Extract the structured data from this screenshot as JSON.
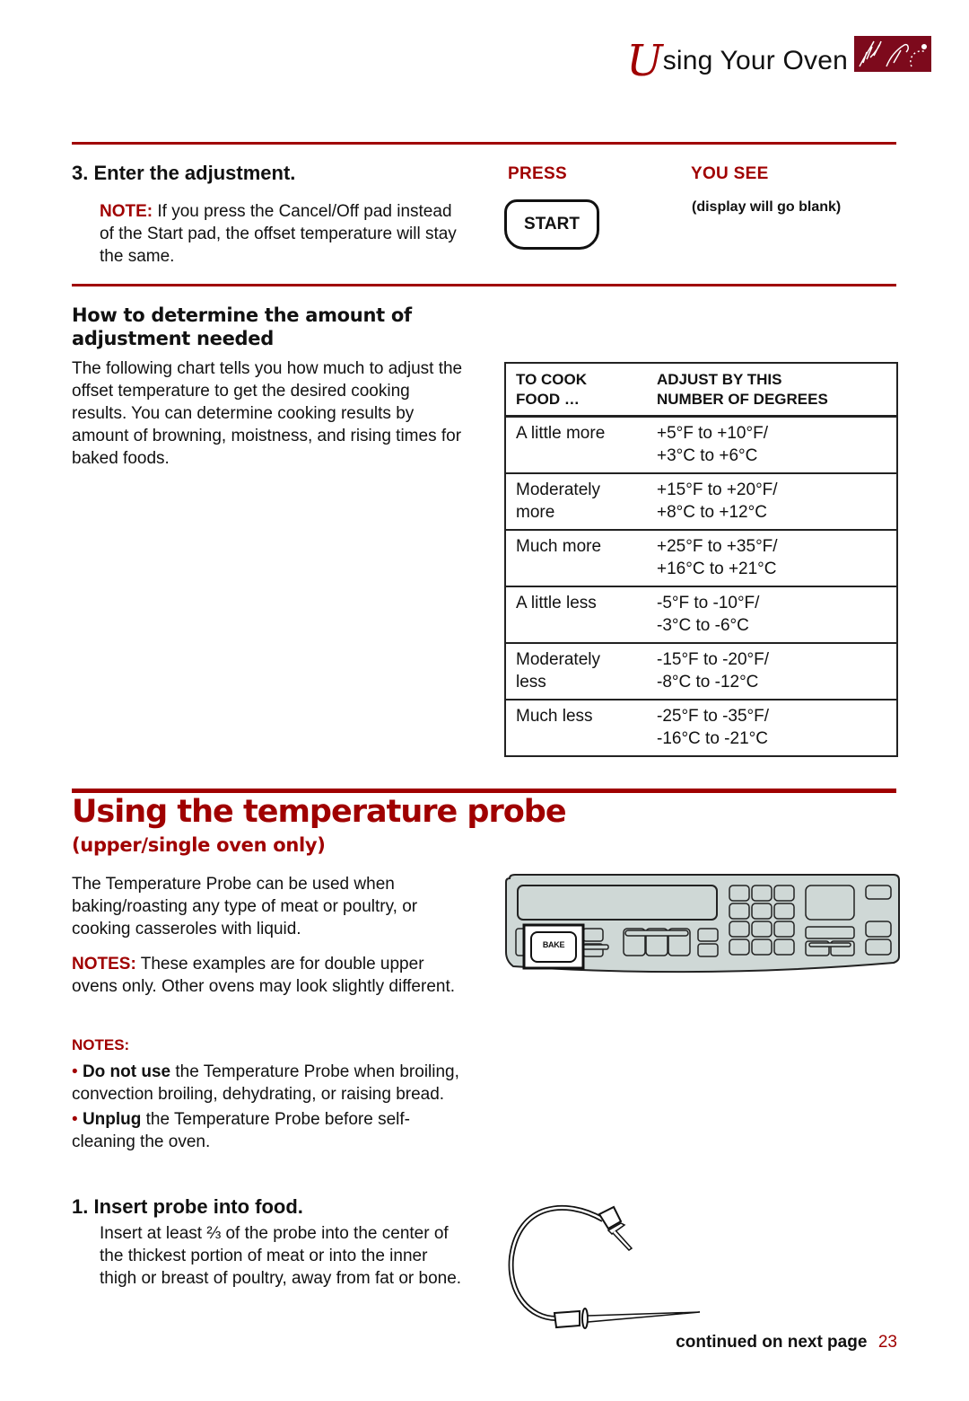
{
  "header": {
    "title_initial": "U",
    "title_rest": "sing Your Oven",
    "logo_icon": "decorative-flourish-logo"
  },
  "step3": {
    "title": "3. Enter the adjustment.",
    "note_label": "NOTE:",
    "note_text": " If you press the Cancel/Off pad instead of the Start pad, the offset temperature will stay the same.",
    "press_header": "PRESS",
    "you_see_header": "YOU SEE",
    "button_label": "START",
    "you_see_text": "(display will go blank)"
  },
  "adjustment": {
    "heading": "How to determine the amount of adjustment needed",
    "body": "The following chart tells you how much to adjust the offset temperature to get the desired cooking results. You can determine cooking results by amount of browning, moistness, and rising times for baked foods.",
    "table": {
      "headers": [
        "TO COOK FOOD …",
        "ADJUST BY THIS NUMBER OF DEGREES"
      ],
      "header_lines": [
        [
          "TO COOK",
          "FOOD …"
        ],
        [
          "ADJUST BY THIS",
          "NUMBER OF DEGREES"
        ]
      ],
      "rows": [
        {
          "food": [
            "A little more",
            ""
          ],
          "degrees": [
            "+5°F to +10°F/",
            "+3°C to +6°C"
          ]
        },
        {
          "food": [
            "Moderately",
            "more"
          ],
          "degrees": [
            "+15°F to +20°F/",
            "+8°C to +12°C"
          ]
        },
        {
          "food": [
            "Much more",
            ""
          ],
          "degrees": [
            "+25°F to +35°F/",
            "+16°C to +21°C"
          ]
        },
        {
          "food": [
            "A little less",
            ""
          ],
          "degrees": [
            "-5°F to -10°F/",
            "-3°C to -6°C"
          ]
        },
        {
          "food": [
            "Moderately",
            "less"
          ],
          "degrees": [
            "-15°F to -20°F/",
            "-8°C to -12°C"
          ]
        },
        {
          "food": [
            "Much less",
            ""
          ],
          "degrees": [
            "-25°F to -35°F/",
            "-16°C to -21°C"
          ]
        }
      ]
    }
  },
  "probe_section": {
    "title": "Using the temperature probe",
    "subtitle": "(upper/single oven only)",
    "intro": "The Temperature Probe can be used when baking/roasting any type of meat or poultry, or cooking casseroles with liquid.",
    "notes_label": "NOTES:",
    "notes_text": " These examples are for double upper ovens only. Other ovens may look slightly different.",
    "notes_header": "NOTES:",
    "bullets": [
      {
        "bold": "Do not use",
        "text": " the Temperature Probe when broiling, convection broiling, dehydrating, or raising bread."
      },
      {
        "bold": "Unplug",
        "text": " the Temperature Probe before self-cleaning the oven."
      }
    ],
    "panel_button_label": "BAKE",
    "step1_title": "1. Insert probe into food.",
    "step1_text": "Insert at least ⅔ of the probe into the center of the thickest portion of meat or into the inner thigh or breast of poultry, away from fat or bone."
  },
  "footer": {
    "continued": "continued on next page",
    "page_number": "23"
  },
  "colors": {
    "accent": "#a00000",
    "logo_bg": "#7d0a1c",
    "panel_bg": "#cfd8d6"
  }
}
